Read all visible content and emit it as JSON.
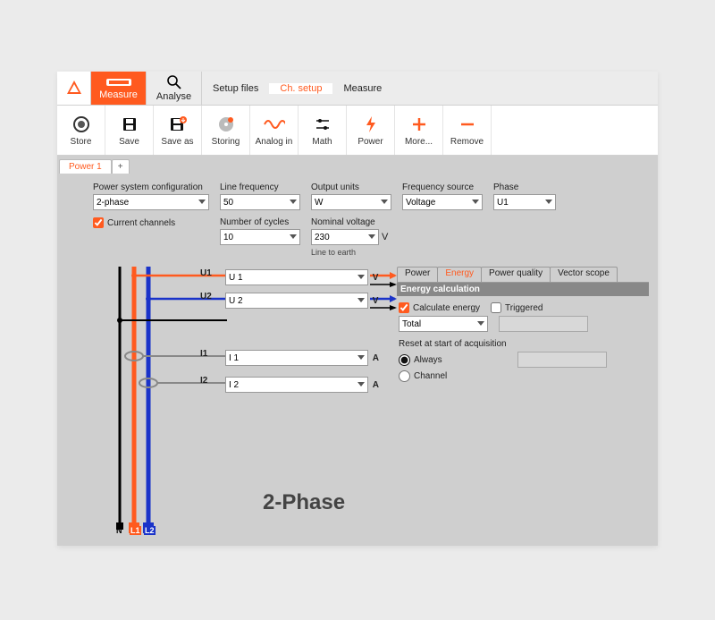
{
  "colors": {
    "accent": "#ff5a1f",
    "blue": "#1a33c9",
    "black": "#000"
  },
  "menubar": {
    "measure": "Measure",
    "analyse": "Analyse",
    "setup_files": "Setup files",
    "ch_setup": "Ch. setup",
    "measure2": "Measure"
  },
  "toolbar": {
    "store": "Store",
    "save": "Save",
    "saveas": "Save as",
    "storing": "Storing",
    "analogin": "Analog in",
    "math": "Math",
    "power": "Power",
    "more": "More...",
    "remove": "Remove"
  },
  "page": {
    "tab": "Power 1",
    "add": "+"
  },
  "config": {
    "psc_label": "Power system configuration",
    "psc_value": "2-phase",
    "line_freq_label": "Line frequency",
    "line_freq_value": "50",
    "out_units_label": "Output units",
    "out_units_value": "W",
    "freq_src_label": "Frequency source",
    "freq_src_value": "Voltage",
    "phase_label": "Phase",
    "phase_value": "U1",
    "current_ch_label": "Current channels",
    "current_ch_checked": true,
    "num_cycles_label": "Number of cycles",
    "num_cycles_value": "10",
    "nom_v_label": "Nominal voltage",
    "nom_v_value": "230",
    "nom_v_unit": "V",
    "nom_v_hint": "Line to earth"
  },
  "channels": {
    "u1_label": "U1",
    "u1_value": "U 1",
    "u1_unit": "V",
    "u2_label": "U2",
    "u2_value": "U 2",
    "u2_unit": "V",
    "i1_label": "I1",
    "i1_value": "I 1",
    "i1_unit": "A",
    "i2_label": "I2",
    "i2_value": "I 2",
    "i2_unit": "A"
  },
  "diagram": {
    "title": "2-Phase",
    "n": "N",
    "l1": "L1",
    "l2": "L2"
  },
  "right": {
    "tab_power": "Power",
    "tab_energy": "Energy",
    "tab_pq": "Power quality",
    "tab_vs": "Vector scope",
    "section": "Energy calculation",
    "calc_energy_label": "Calculate energy",
    "calc_energy_checked": true,
    "triggered_label": "Triggered",
    "triggered_checked": false,
    "mode_value": "Total",
    "reset_label": "Reset at start of acquisition",
    "reset_always": "Always",
    "reset_channel": "Channel",
    "reset_value": "always"
  }
}
